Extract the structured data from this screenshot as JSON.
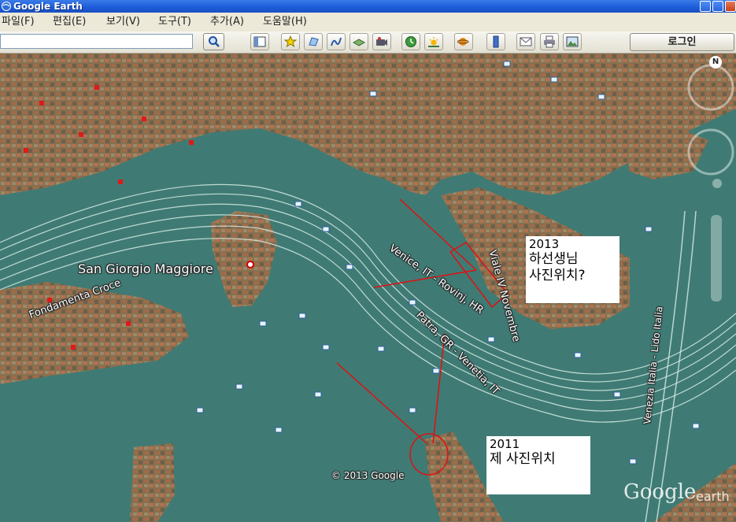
{
  "window": {
    "title": "Google Earth"
  },
  "menu": [
    "파일(F)",
    "편집(E)",
    "보기(V)",
    "도구(T)",
    "추가(A)",
    "도움말(H)"
  ],
  "toolbar": {
    "search_value": "",
    "login_label": "로그인",
    "buttons": [
      "sidebar-toggle",
      "placemark",
      "polygon",
      "path",
      "image-overlay",
      "record-tour",
      "historical-imagery",
      "sunlight",
      "planet-switch",
      "ruler",
      "email",
      "print",
      "save-image"
    ]
  },
  "map": {
    "labels": {
      "san_giorgio": "San Giorgio Maggiore",
      "fondamenta": "Fondamenta Croce",
      "route1": "Venice, IT - Rovinj, HR",
      "route2": "Patra, GR - Venetia, IT",
      "viale": "Viale IV Novembre",
      "lido": "Venezia Italia - Lido Italia",
      "copyright": "© 2013 Google"
    },
    "logo": {
      "google": "Google",
      "earth": "earth"
    },
    "compass_label": "N",
    "note_2013": {
      "year": "2013",
      "line1": "하선생님",
      "line2": "사진위치?"
    },
    "note_2011": {
      "year": "2011",
      "line1": "제 사진위치"
    },
    "colors": {
      "water": "#3f7b74",
      "channel": "#5c938b",
      "city": "#8b7258",
      "annotation": "#e01010"
    }
  }
}
